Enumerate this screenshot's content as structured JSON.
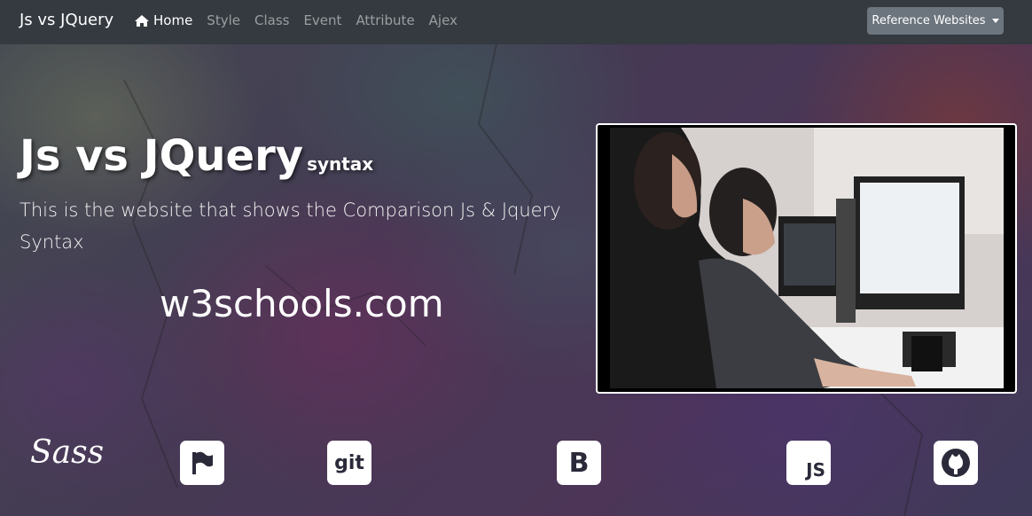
{
  "navbar": {
    "brand": "Js vs JQuery",
    "items": [
      {
        "label": "Home",
        "active": true,
        "icon": "home-icon"
      },
      {
        "label": "Style"
      },
      {
        "label": "Class"
      },
      {
        "label": "Event"
      },
      {
        "label": "Attribute"
      },
      {
        "label": "Ajex"
      }
    ],
    "dropdown_label": "Reference Websites"
  },
  "hero": {
    "title": "Js vs JQuery",
    "title_small": "syntax",
    "lead": "This is the website that shows the Comparison Js & Jquery Syntax",
    "w3_text": "w3schools.com"
  },
  "icons": [
    {
      "name": "sass-icon",
      "text": "Sass"
    },
    {
      "name": "flag-icon"
    },
    {
      "name": "git-icon",
      "text": "git"
    },
    {
      "name": "bootstrap-icon",
      "text": "B"
    },
    {
      "name": "js-icon",
      "text": "JS"
    },
    {
      "name": "github-icon"
    }
  ],
  "colors": {
    "navbar_bg": "#343a40",
    "dropdown_bg": "#6c757d"
  }
}
